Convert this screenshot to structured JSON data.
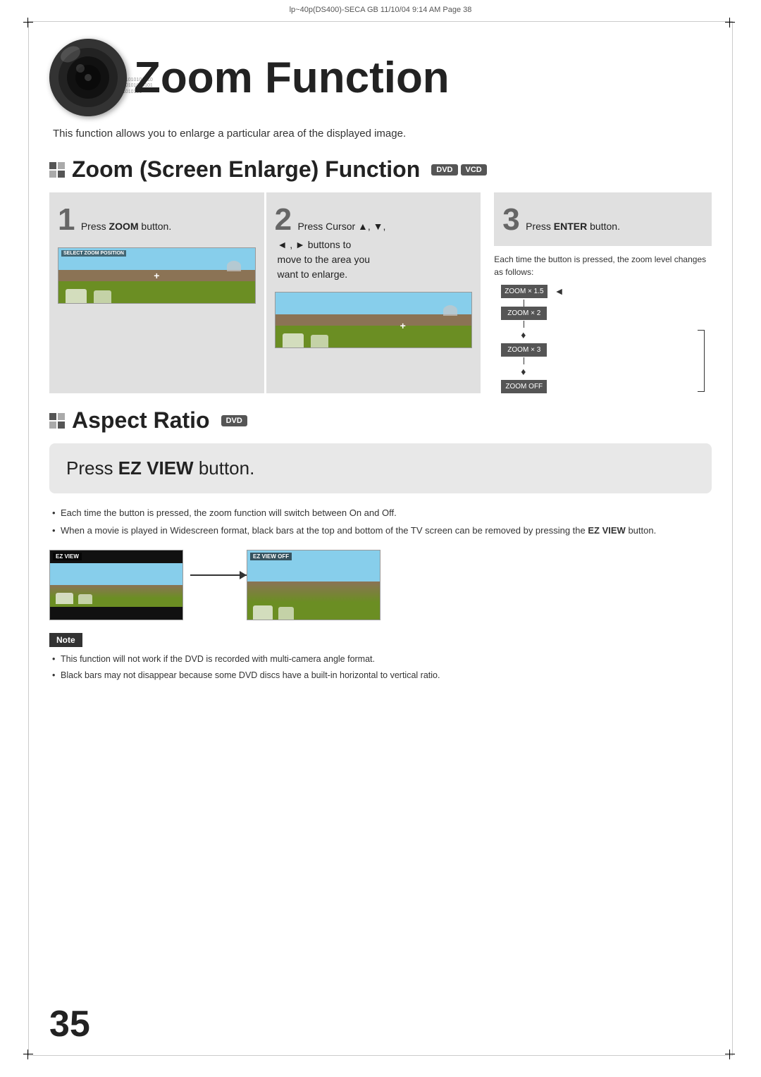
{
  "meta": {
    "header_line": "lp~40p(DS400)-SECA GB  11/10/04  9:14 AM  Page 38",
    "page_number": "35"
  },
  "page_title": "Zoom Function",
  "page_subtitle": "This function allows you to enlarge a particular area of the displayed image.",
  "binary_text": "01010010101010101010101010101010101010101010010101010101010101010101010101010101010101",
  "section1": {
    "title": "Zoom (Screen Enlarge) Function",
    "badge1": "DVD",
    "badge2": "VCD",
    "steps": [
      {
        "number": "1",
        "label": "Press ZOOM button.",
        "plain": "Press ",
        "bold": "ZOOM",
        "tail": " button.",
        "screen_label": "SELECT ZOOM POSITION"
      },
      {
        "number": "2",
        "label": "Press Cursor ▲, ▼, ◄, ► buttons to move to the area you want to enlarge.",
        "plain1": "Press Cursor ▲, ▼,",
        "plain2": "◄ , ► buttons to",
        "plain3": "move to the area you",
        "plain4": "want to enlarge."
      },
      {
        "number": "3",
        "label": "Press ENTER button.",
        "plain": "Press ",
        "bold": "ENTER",
        "tail": " button.",
        "note": "Each time the button is pressed, the zoom level changes as follows:",
        "zoom_levels": [
          {
            "label": "ZOOM × 1.5",
            "arrow": "◄"
          },
          {
            "label": "ZOOM × 2",
            "arrow": "♦"
          },
          {
            "label": "ZOOM × 3",
            "arrow": "♦"
          },
          {
            "label": "ZOOM OFF",
            "arrow": ""
          }
        ]
      }
    ]
  },
  "section2": {
    "title": "Aspect Ratio",
    "badge": "DVD",
    "ezview_instruction": "Press EZ VIEW button.",
    "ezview_plain": "Press ",
    "ezview_bold": "EZ VIEW",
    "ezview_tail": " button.",
    "bullets": [
      {
        "text": "Each time the button is pressed, the zoom function will switch between On and Off."
      },
      {
        "text_plain": "When a movie is played in Widescreen format, black bars at the top and bottom of the TV screen can be removed by pressing the ",
        "text_bold": "EZ VIEW",
        "text_tail": " button."
      }
    ],
    "ez_view_label": "EZ VIEW",
    "ez_view_off_label": "EZ VIEW OFF",
    "note_label": "Note",
    "notes": [
      "This function will not work if the DVD is recorded with multi-camera angle format.",
      "Black bars may not disappear because some DVD discs have a built-in horizontal to vertical ratio."
    ]
  }
}
